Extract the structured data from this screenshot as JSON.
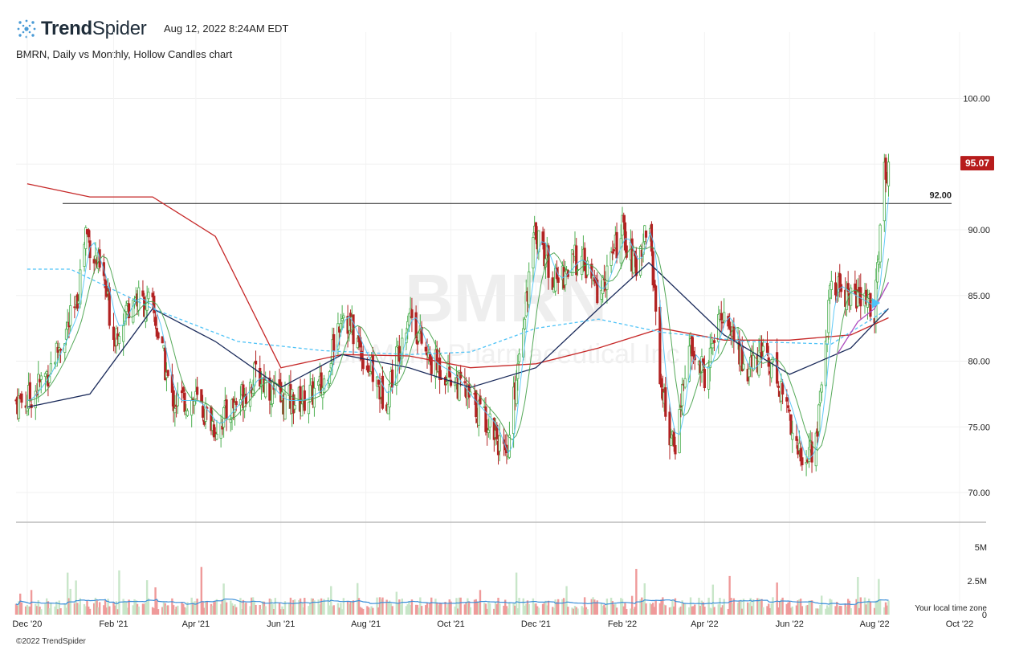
{
  "header": {
    "brand_bold": "Trend",
    "brand_light": "Spider",
    "timestamp": "Aug 12, 2022 8:24AM EDT",
    "chart_title": "BMRN, Daily vs Monthly, Hollow Candles chart"
  },
  "watermark": {
    "ticker": "BMRN",
    "company": "BioMarin Pharmaceutical Inc"
  },
  "footer": {
    "copyright": "©2022 TrendSpider",
    "timezone_note": "Your local time zone"
  },
  "colors": {
    "up": "#4caf50",
    "down": "#b22222",
    "ma_red": "#c62828",
    "ma_navy": "#1a2a5a",
    "ma_green": "#43a047",
    "ma_cyan": "#4fc3f7",
    "ma_purple": "#ab47bc",
    "last_price_bg": "#b71c1c"
  },
  "chart_data": {
    "type": "line",
    "title": "BMRN, Daily vs Monthly, Hollow Candles chart",
    "price_axis": {
      "ticks": [
        "100.00",
        "95.00",
        "90.00",
        "85.00",
        "80.00",
        "75.00",
        "70.00"
      ],
      "ylim": [
        68.5,
        105
      ]
    },
    "volume_axis": {
      "ticks": [
        "5M",
        "2.5M",
        "0"
      ],
      "ylim": [
        0,
        7000000
      ]
    },
    "x_ticks": [
      "Dec '20",
      "Feb '21",
      "Apr '21",
      "Jun '21",
      "Aug '21",
      "Oct '21",
      "Dec '21",
      "Feb '22",
      "Apr '22",
      "Jun '22",
      "Aug '22",
      "Oct '22"
    ],
    "horizontal_level": {
      "value": 92.0,
      "label": "92.00"
    },
    "last_price": {
      "value": 95.07,
      "label": "95.07"
    },
    "close_series": {
      "name": "BMRN close",
      "x": [
        "2020-12-01",
        "2020-12-15",
        "2021-01-05",
        "2021-01-12",
        "2021-01-18",
        "2021-01-25",
        "2021-02-01",
        "2021-02-15",
        "2021-03-01",
        "2021-03-15",
        "2021-04-01",
        "2021-04-15",
        "2021-05-01",
        "2021-05-15",
        "2021-06-01",
        "2021-06-15",
        "2021-07-01",
        "2021-07-15",
        "2021-08-01",
        "2021-08-15",
        "2021-09-01",
        "2021-09-15",
        "2021-10-01",
        "2021-10-15",
        "2021-11-01",
        "2021-11-10",
        "2021-11-20",
        "2021-12-01",
        "2021-12-15",
        "2022-01-01",
        "2022-01-15",
        "2022-02-01",
        "2022-02-10",
        "2022-02-20",
        "2022-03-01",
        "2022-03-10",
        "2022-03-20",
        "2022-04-01",
        "2022-04-15",
        "2022-05-01",
        "2022-05-15",
        "2022-06-01",
        "2022-06-10",
        "2022-06-20",
        "2022-07-01",
        "2022-07-15",
        "2022-08-01",
        "2022-08-08",
        "2022-08-11"
      ],
      "y": [
        77,
        79,
        84,
        90,
        88,
        86,
        82,
        85,
        84,
        77,
        77,
        75,
        77,
        79,
        77,
        77,
        78,
        84,
        80,
        77,
        84,
        80,
        79,
        77,
        75,
        72,
        82,
        90,
        86,
        88,
        85,
        90,
        87,
        91,
        78,
        73,
        81,
        79,
        84,
        79,
        81,
        76,
        72,
        74,
        86,
        85,
        84,
        94,
        95.07
      ]
    },
    "moving_averages": [
      {
        "name": "MA red",
        "x": [
          "2020-12-01",
          "2021-01-15",
          "2021-03-01",
          "2021-04-15",
          "2021-06-01",
          "2021-07-15",
          "2021-09-01",
          "2021-10-15",
          "2021-12-01",
          "2022-01-15",
          "2022-03-01",
          "2022-04-15",
          "2022-06-01",
          "2022-07-15",
          "2022-08-11"
        ],
        "y": [
          93.5,
          92.5,
          92.5,
          89.5,
          79.5,
          80.5,
          80.4,
          79.5,
          79.8,
          81,
          82.5,
          81.6,
          81.6,
          82,
          83.3
        ]
      },
      {
        "name": "MA navy",
        "x": [
          "2020-12-01",
          "2021-01-15",
          "2021-03-01",
          "2021-04-15",
          "2021-06-01",
          "2021-07-15",
          "2021-09-01",
          "2021-10-15",
          "2021-12-01",
          "2022-01-15",
          "2022-02-20",
          "2022-04-15",
          "2022-06-01",
          "2022-07-15",
          "2022-08-11"
        ],
        "y": [
          76.5,
          77.5,
          84,
          81.5,
          78,
          80.5,
          79.5,
          78,
          79.5,
          84,
          87.5,
          82,
          79,
          81,
          84
        ]
      },
      {
        "name": "MA cyan dashed",
        "x": [
          "2020-12-01",
          "2021-01-01",
          "2021-03-01",
          "2021-05-01",
          "2021-07-01",
          "2021-09-01",
          "2021-10-15",
          "2021-12-01",
          "2022-01-15",
          "2022-03-01",
          "2022-05-01",
          "2022-07-01",
          "2022-08-11"
        ],
        "y": [
          87,
          87,
          84,
          81.5,
          80.8,
          80.5,
          80.7,
          82.5,
          83.2,
          82.2,
          81.5,
          81.3,
          84
        ]
      }
    ]
  }
}
